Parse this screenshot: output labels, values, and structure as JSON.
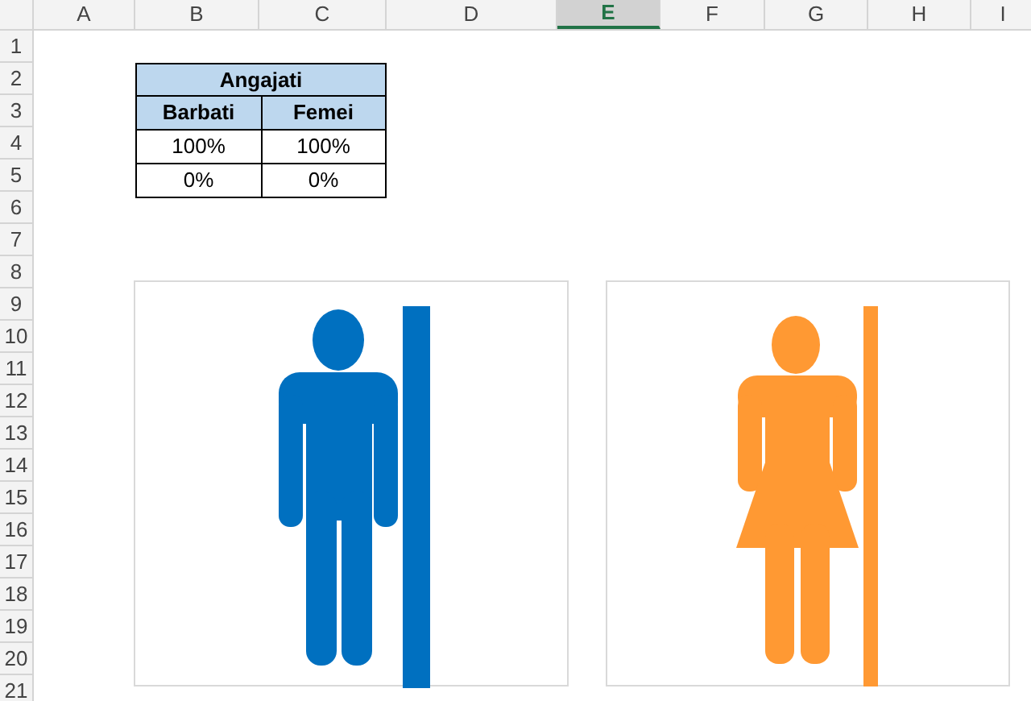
{
  "columns": [
    {
      "label": "A",
      "selected": false
    },
    {
      "label": "B",
      "selected": false
    },
    {
      "label": "C",
      "selected": false
    },
    {
      "label": "D",
      "selected": false
    },
    {
      "label": "E",
      "selected": true
    },
    {
      "label": "F",
      "selected": false
    },
    {
      "label": "G",
      "selected": false
    },
    {
      "label": "H",
      "selected": false
    },
    {
      "label": "I",
      "selected": false
    }
  ],
  "rows": [
    "1",
    "2",
    "3",
    "4",
    "5",
    "6",
    "7",
    "8",
    "9",
    "10",
    "11",
    "12",
    "13",
    "14",
    "15",
    "16",
    "17",
    "18",
    "19",
    "20",
    "21"
  ],
  "table": {
    "title": "Angajati",
    "headers": [
      "Barbati",
      "Femei"
    ],
    "rows": [
      [
        "100%",
        "100%"
      ],
      [
        "0%",
        "0%"
      ]
    ]
  },
  "charts": [
    {
      "kind": "male",
      "color": "#0070c0"
    },
    {
      "kind": "female",
      "color": "#ff9933"
    }
  ]
}
